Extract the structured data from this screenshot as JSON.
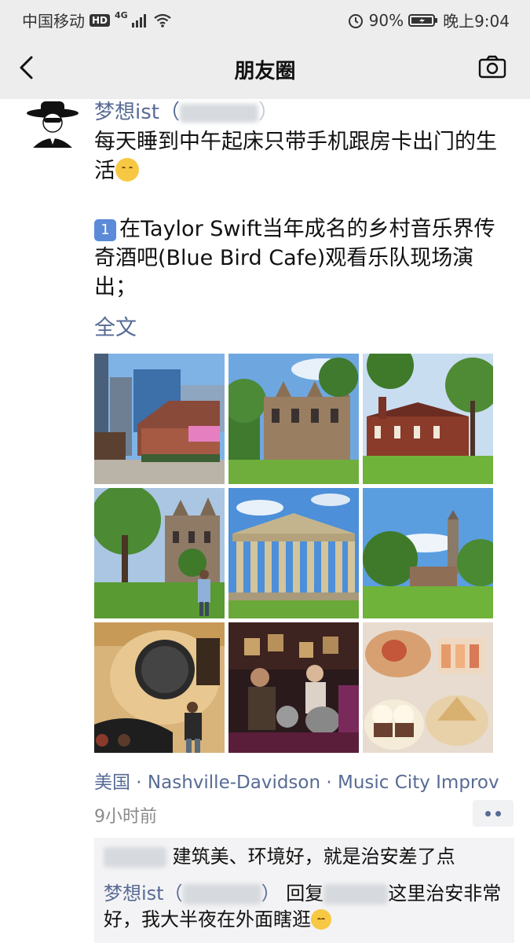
{
  "status_bar": {
    "carrier": "中国移动",
    "hd": "HD",
    "network": "4G",
    "battery": "90%",
    "time": "晚上9:04"
  },
  "nav": {
    "title": "朋友圈",
    "back_icon": "chevron-left-icon",
    "camera_icon": "camera-icon"
  },
  "post": {
    "author": "梦想ist（",
    "text_line1": "每天睡到中午起床只带手机跟房卡出门的生活",
    "item_number": "1",
    "text_item1": "在Taylor Swift当年成名的乡村音乐界传奇酒吧(Blue Bird Cafe)观看乐队现场演出；",
    "full_text_link": "全文",
    "photos": [
      "city-street-photo",
      "gothic-building-photo",
      "brick-hall-photo",
      "campus-person-photo",
      "parthenon-photo",
      "campus-tower-photo",
      "guitar-photo",
      "band-live-photo",
      "desserts-photo"
    ],
    "location": "美国 · Nashville-Davidson · Music City Improv",
    "time_ago": "9小时前"
  },
  "comments": [
    {
      "text": "建筑美、环境好，就是治安差了点"
    },
    {
      "author": "梦想ist（",
      "author_close": "）",
      "reply_word": "回复",
      "text": "这里治安非常好，我大半夜在外面瞎逛"
    }
  ],
  "colors": {
    "link": "#576b95",
    "bar_bg": "#ededed"
  }
}
